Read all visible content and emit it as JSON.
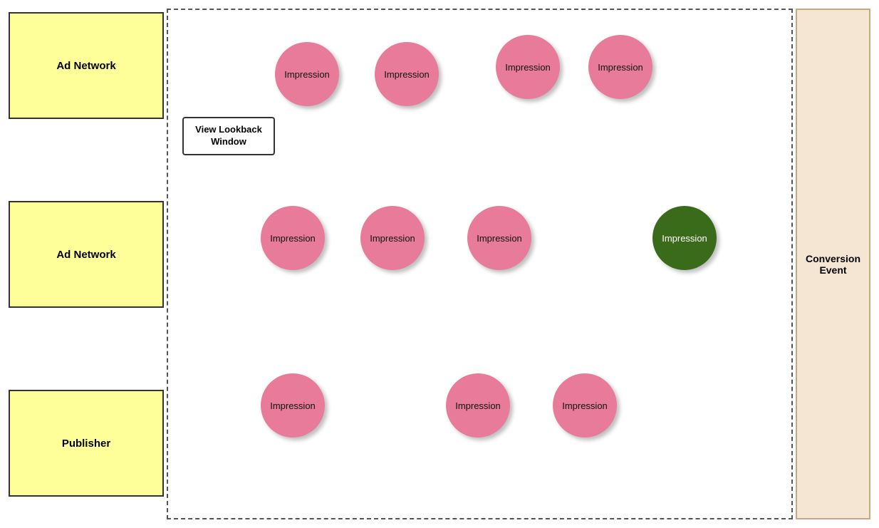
{
  "sidebar": {
    "box1": {
      "label": "Ad Network"
    },
    "box2": {
      "label": "Ad Network"
    },
    "box3": {
      "label": "Publisher"
    }
  },
  "right_panel": {
    "label": "Conversion\nEvent"
  },
  "lookback_button": {
    "label": "View Lookback\nWindow"
  },
  "impressions": {
    "pink_label": "Impression",
    "green_label": "Impression"
  }
}
